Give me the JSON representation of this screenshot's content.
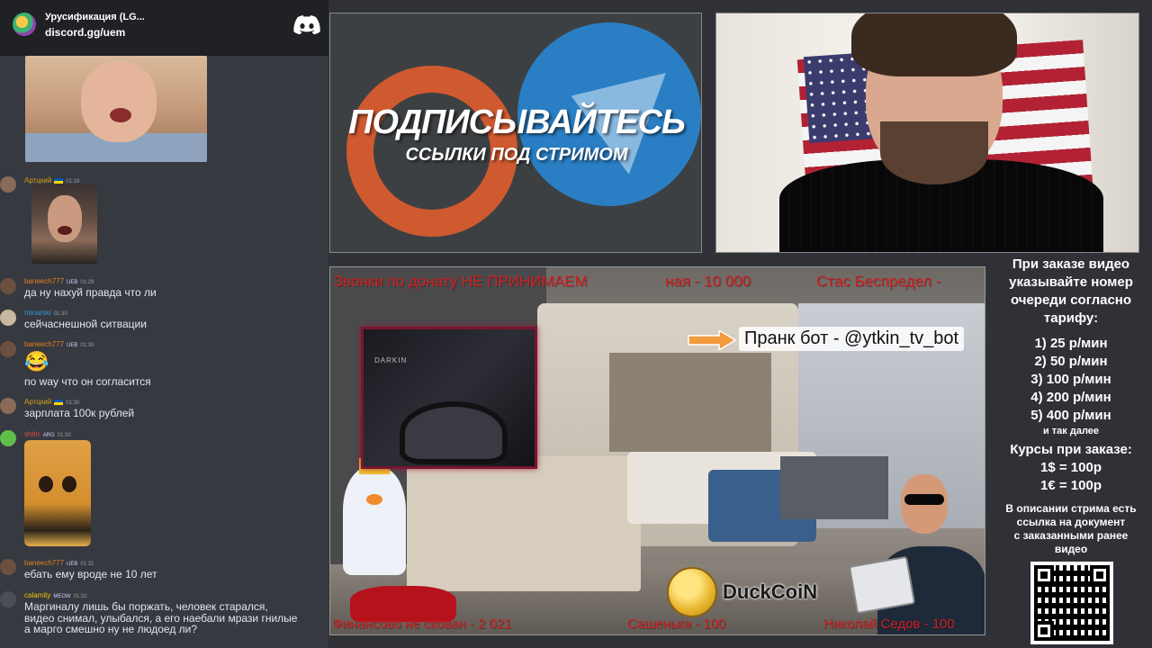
{
  "discord": {
    "title": "Урусификация (LG...",
    "link": "discord.gg/uem",
    "icon": "discord-icon"
  },
  "chat": {
    "messages": [
      {
        "user": "Артцкий",
        "time": "01:28",
        "text": "",
        "color": "#d4a017"
      },
      {
        "user": "baneech777",
        "badges": "UEB",
        "time": "01:29",
        "text": "да ну нахуй правда что ли",
        "color": "#e67e22"
      },
      {
        "user": "minarski",
        "time": "01:30",
        "text": "сейчаснешной ситвации",
        "color": "#3498db"
      },
      {
        "user": "baneech777",
        "badges": "UEB",
        "time": "01:30",
        "emoji": "😂",
        "text": "no way что он согласится",
        "color": "#e67e22"
      },
      {
        "user": "Артцкий",
        "time": "01:30",
        "text": "зарплата 100к рублей",
        "color": "#d4a017"
      },
      {
        "user": "shtirr",
        "badges": "ARG",
        "time": "01:30",
        "text": "",
        "color": "#e74c3c"
      },
      {
        "user": "baneech777",
        "badges": "UEB",
        "time": "01:31",
        "text": "ебать ему вроде не 10 лет",
        "color": "#e67e22"
      },
      {
        "user": "calamity",
        "badges": "MEOW",
        "time": "01:32",
        "text_lines": [
          "Маргиналу лишь бы поржать, человек старался,",
          "видео снимал, улыбался, а его наебали мрази гнилые",
          "а марго смешно ну не людоед ли?"
        ],
        "color": "#f1c40f"
      }
    ]
  },
  "promo": {
    "title": "ПОДПИСЫВАЙТЕСЬ",
    "subtitle": "ССЫЛКИ ПОД СТРИМОМ"
  },
  "scene": {
    "top_ticker_left": "Звонки по донату НЕ ПРИНИМАЕМ",
    "top_ticker_mid": "ная - 10 000",
    "top_ticker_right": "Стас Беспредел -",
    "prank": "Пранк бот - @ytkin_tv_bot",
    "streamer_brand": "DARKIN",
    "coin_label": "DuckCoiN",
    "bottom_ticker_left": "Финансово не скован - 2 021",
    "bottom_ticker_mid": "Сашенька - 100",
    "bottom_ticker_right": "Николай Седов - 100"
  },
  "info": {
    "heading_lines": [
      "При заказе видео",
      "указывайте номер",
      "очереди согласно",
      "тарифу:"
    ],
    "tariffs": [
      "1) 25 р/мин",
      "2) 50 р/мин",
      "3) 100 р/мин",
      "4) 200 р/мин",
      "5) 400 р/мин"
    ],
    "etc": "и так далее",
    "courses_title": "Курсы при заказе:",
    "rates": [
      "1$ = 100р",
      "1€ = 100р"
    ],
    "note_lines": [
      "В описании стрима есть",
      "ссылка на документ",
      "с заказанными ранее",
      "видео"
    ]
  },
  "colors": {
    "chat_bg": "#36393f",
    "ticker_red": "#d41f1f",
    "telegram_blue": "#2a7ec3",
    "patreon_red": "#d05a2f"
  }
}
